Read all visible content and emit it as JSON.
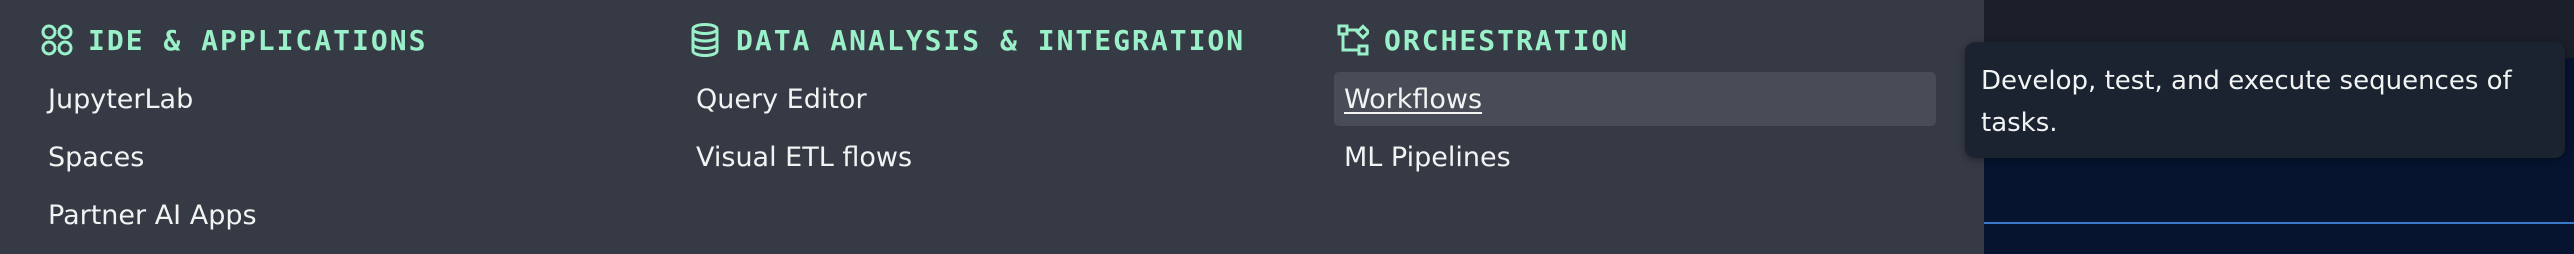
{
  "columns": [
    {
      "title": "IDE & APPLICATIONS",
      "icon": "apps-grid-icon",
      "items": [
        "JupyterLab",
        "Spaces",
        "Partner AI Apps"
      ]
    },
    {
      "title": "DATA ANALYSIS & INTEGRATION",
      "icon": "database-icon",
      "items": [
        "Query Editor",
        "Visual ETL flows"
      ]
    },
    {
      "title": "ORCHESTRATION",
      "icon": "workflow-icon",
      "items": [
        "Workflows",
        "ML Pipelines"
      ]
    }
  ],
  "tooltip": {
    "text": "Develop, test, and execute sequences of tasks."
  },
  "colors": {
    "panel_bg": "#363a45",
    "header_accent": "#9af0c8",
    "item_text": "#f2f3f3",
    "hover_bg": "#484c57",
    "tooltip_bg": "#1b2331",
    "backdrop": "#061430",
    "backdrop_line": "#3a78c8"
  }
}
